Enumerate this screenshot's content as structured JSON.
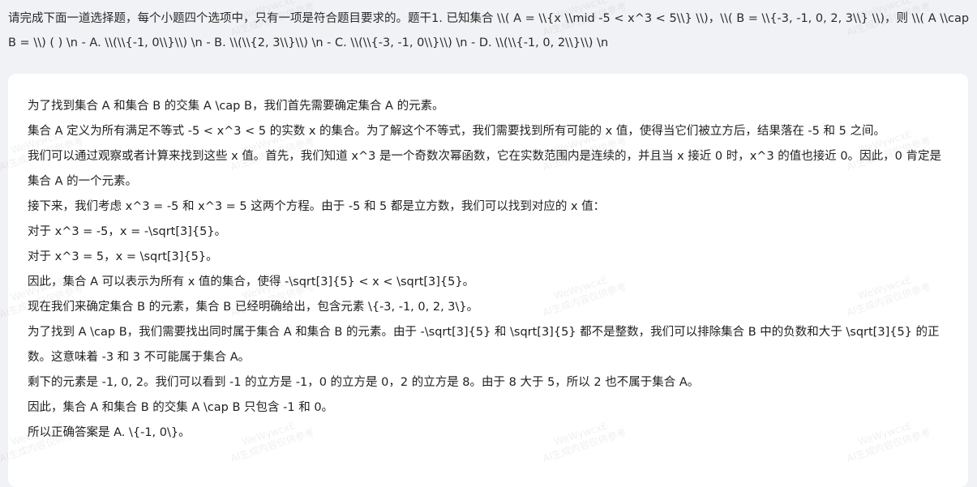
{
  "question": {
    "text": "请完成下面一道选择题，每个小题四个选项中，只有一项是符合题目要求的。题干1. 已知集合 \\\\( A = \\\\{x \\\\mid -5 < x^3 < 5\\\\} \\\\)，\\\\( B = \\\\{-3, -1, 0, 2, 3\\\\} \\\\)，则 \\\\( A \\\\cap B = \\\\) ( ) \\n - A. \\\\(\\\\{-1, 0\\\\}\\\\) \\n - B. \\\\(\\\\{2, 3\\\\}\\\\) \\n - C. \\\\(\\\\{-3, -1, 0\\\\}\\\\) \\n - D. \\\\(\\\\{-1, 0, 2\\\\}\\\\) \\n"
  },
  "answer": {
    "lines": [
      "为了找到集合 A 和集合 B 的交集 A \\cap B，我们首先需要确定集合 A 的元素。",
      "集合 A 定义为所有满足不等式 -5 < x^3 < 5 的实数 x 的集合。为了解这个不等式，我们需要找到所有可能的 x 值，使得当它们被立方后，结果落在 -5 和 5 之间。",
      "我们可以通过观察或者计算来找到这些 x 值。首先，我们知道 x^3 是一个奇数次幂函数，它在实数范围内是连续的，并且当 x 接近 0 时，x^3 的值也接近 0。因此，0 肯定是集合 A 的一个元素。",
      "接下来，我们考虑 x^3 = -5 和 x^3 = 5 这两个方程。由于 -5 和 5 都是立方数，我们可以找到对应的 x 值：",
      "对于 x^3 = -5，x = -\\sqrt[3]{5}。",
      "对于 x^3 = 5，x = \\sqrt[3]{5}。",
      "因此，集合 A 可以表示为所有 x 值的集合，使得 -\\sqrt[3]{5} < x < \\sqrt[3]{5}。",
      "现在我们来确定集合 B 的元素，集合 B 已经明确给出，包含元素 \\{-3, -1, 0, 2, 3\\}。",
      "为了找到 A \\cap B，我们需要找出同时属于集合 A 和集合 B 的元素。由于 -\\sqrt[3]{5} 和 \\sqrt[3]{5} 都不是整数，我们可以排除集合 B 中的负数和大于 \\sqrt[3]{5} 的正数。这意味着 -3 和 3 不可能属于集合 A。",
      "剩下的元素是 -1, 0, 2。我们可以看到 -1 的立方是 -1，0 的立方是 0，2 的立方是 8。由于 8 大于 5，所以 2 也不属于集合 A。",
      "因此，集合 A 和集合 B 的交集 A \\cap B 只包含 -1 和 0。",
      "所以正确答案是 A. \\{-1, 0\\}。"
    ]
  },
  "watermark": {
    "line1": "WeWywcxE",
    "line2": "AI生成内容仅供参考"
  },
  "colors": {
    "page_background": "#f1f2f5",
    "card_background": "#ffffff",
    "text": "#1f1f1f"
  }
}
